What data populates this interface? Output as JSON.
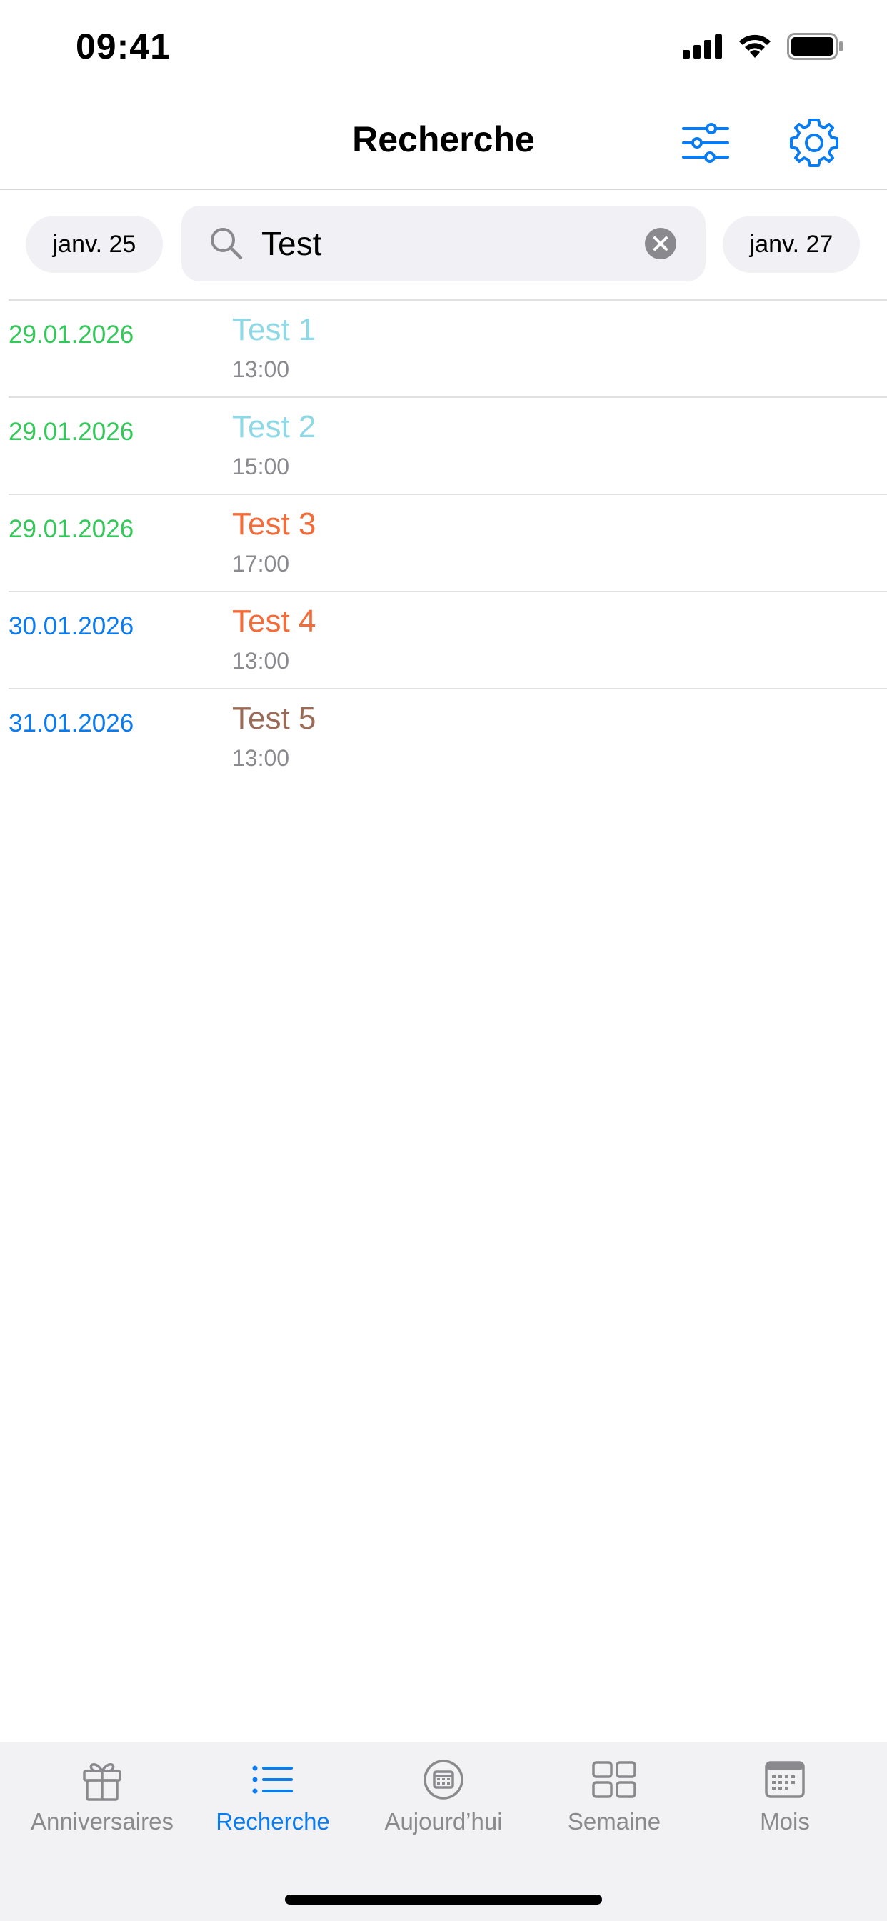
{
  "status_bar": {
    "time": "09:41"
  },
  "nav": {
    "title": "Recherche"
  },
  "search": {
    "prev_date": "janv. 25",
    "next_date": "janv. 27",
    "query": "Test"
  },
  "results": [
    {
      "date": "29.01.2026",
      "title": "Test 1",
      "time": "13:00",
      "date_color": "#34c759",
      "title_color": "#8fd8e6"
    },
    {
      "date": "29.01.2026",
      "title": "Test 2",
      "time": "15:00",
      "date_color": "#34c759",
      "title_color": "#8fd8e6"
    },
    {
      "date": "29.01.2026",
      "title": "Test 3",
      "time": "17:00",
      "date_color": "#34c759",
      "title_color": "#f26b38"
    },
    {
      "date": "30.01.2026",
      "title": "Test 4",
      "time": "13:00",
      "date_color": "#0a7cf0",
      "title_color": "#f26b38"
    },
    {
      "date": "31.01.2026",
      "title": "Test 5",
      "time": "13:00",
      "date_color": "#0a7cf0",
      "title_color": "#9c6b58"
    }
  ],
  "tabs": [
    {
      "label": "Anniversaires",
      "icon": "gift-icon",
      "active": false
    },
    {
      "label": "Recherche",
      "icon": "list-icon",
      "active": true
    },
    {
      "label": "Aujourd’hui",
      "icon": "today-icon",
      "active": false
    },
    {
      "label": "Semaine",
      "icon": "grid-icon",
      "active": false
    },
    {
      "label": "Mois",
      "icon": "calendar-icon",
      "active": false
    }
  ],
  "colors": {
    "accent": "#0a7cf0",
    "inactive": "#8a8a8e",
    "pill_bg": "#f0f0f5",
    "tabbar_bg": "#f2f2f4"
  }
}
